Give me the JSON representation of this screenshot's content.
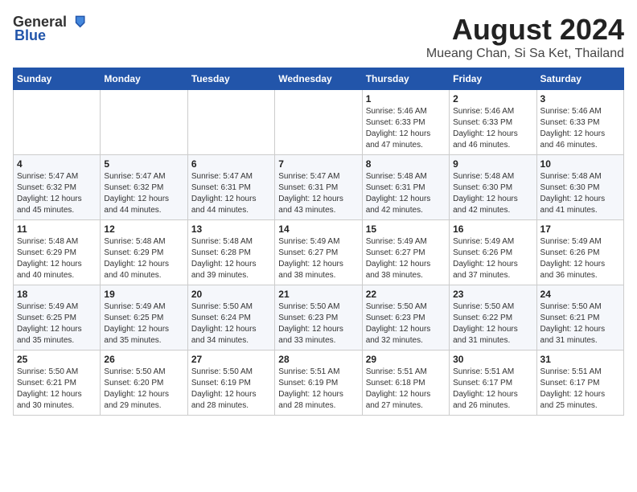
{
  "header": {
    "logo_general": "General",
    "logo_blue": "Blue",
    "month_year": "August 2024",
    "location": "Mueang Chan, Si Sa Ket, Thailand"
  },
  "days_of_week": [
    "Sunday",
    "Monday",
    "Tuesday",
    "Wednesday",
    "Thursday",
    "Friday",
    "Saturday"
  ],
  "weeks": [
    {
      "days": [
        {
          "number": "",
          "info": ""
        },
        {
          "number": "",
          "info": ""
        },
        {
          "number": "",
          "info": ""
        },
        {
          "number": "",
          "info": ""
        },
        {
          "number": "1",
          "sunrise": "5:46 AM",
          "sunset": "6:33 PM",
          "daylight": "12 hours and 47 minutes."
        },
        {
          "number": "2",
          "sunrise": "5:46 AM",
          "sunset": "6:33 PM",
          "daylight": "12 hours and 46 minutes."
        },
        {
          "number": "3",
          "sunrise": "5:46 AM",
          "sunset": "6:33 PM",
          "daylight": "12 hours and 46 minutes."
        }
      ]
    },
    {
      "days": [
        {
          "number": "4",
          "sunrise": "5:47 AM",
          "sunset": "6:32 PM",
          "daylight": "12 hours and 45 minutes."
        },
        {
          "number": "5",
          "sunrise": "5:47 AM",
          "sunset": "6:32 PM",
          "daylight": "12 hours and 44 minutes."
        },
        {
          "number": "6",
          "sunrise": "5:47 AM",
          "sunset": "6:31 PM",
          "daylight": "12 hours and 44 minutes."
        },
        {
          "number": "7",
          "sunrise": "5:47 AM",
          "sunset": "6:31 PM",
          "daylight": "12 hours and 43 minutes."
        },
        {
          "number": "8",
          "sunrise": "5:48 AM",
          "sunset": "6:31 PM",
          "daylight": "12 hours and 42 minutes."
        },
        {
          "number": "9",
          "sunrise": "5:48 AM",
          "sunset": "6:30 PM",
          "daylight": "12 hours and 42 minutes."
        },
        {
          "number": "10",
          "sunrise": "5:48 AM",
          "sunset": "6:30 PM",
          "daylight": "12 hours and 41 minutes."
        }
      ]
    },
    {
      "days": [
        {
          "number": "11",
          "sunrise": "5:48 AM",
          "sunset": "6:29 PM",
          "daylight": "12 hours and 40 minutes."
        },
        {
          "number": "12",
          "sunrise": "5:48 AM",
          "sunset": "6:29 PM",
          "daylight": "12 hours and 40 minutes."
        },
        {
          "number": "13",
          "sunrise": "5:48 AM",
          "sunset": "6:28 PM",
          "daylight": "12 hours and 39 minutes."
        },
        {
          "number": "14",
          "sunrise": "5:49 AM",
          "sunset": "6:27 PM",
          "daylight": "12 hours and 38 minutes."
        },
        {
          "number": "15",
          "sunrise": "5:49 AM",
          "sunset": "6:27 PM",
          "daylight": "12 hours and 38 minutes."
        },
        {
          "number": "16",
          "sunrise": "5:49 AM",
          "sunset": "6:26 PM",
          "daylight": "12 hours and 37 minutes."
        },
        {
          "number": "17",
          "sunrise": "5:49 AM",
          "sunset": "6:26 PM",
          "daylight": "12 hours and 36 minutes."
        }
      ]
    },
    {
      "days": [
        {
          "number": "18",
          "sunrise": "5:49 AM",
          "sunset": "6:25 PM",
          "daylight": "12 hours and 35 minutes."
        },
        {
          "number": "19",
          "sunrise": "5:49 AM",
          "sunset": "6:25 PM",
          "daylight": "12 hours and 35 minutes."
        },
        {
          "number": "20",
          "sunrise": "5:50 AM",
          "sunset": "6:24 PM",
          "daylight": "12 hours and 34 minutes."
        },
        {
          "number": "21",
          "sunrise": "5:50 AM",
          "sunset": "6:23 PM",
          "daylight": "12 hours and 33 minutes."
        },
        {
          "number": "22",
          "sunrise": "5:50 AM",
          "sunset": "6:23 PM",
          "daylight": "12 hours and 32 minutes."
        },
        {
          "number": "23",
          "sunrise": "5:50 AM",
          "sunset": "6:22 PM",
          "daylight": "12 hours and 31 minutes."
        },
        {
          "number": "24",
          "sunrise": "5:50 AM",
          "sunset": "6:21 PM",
          "daylight": "12 hours and 31 minutes."
        }
      ]
    },
    {
      "days": [
        {
          "number": "25",
          "sunrise": "5:50 AM",
          "sunset": "6:21 PM",
          "daylight": "12 hours and 30 minutes."
        },
        {
          "number": "26",
          "sunrise": "5:50 AM",
          "sunset": "6:20 PM",
          "daylight": "12 hours and 29 minutes."
        },
        {
          "number": "27",
          "sunrise": "5:50 AM",
          "sunset": "6:19 PM",
          "daylight": "12 hours and 28 minutes."
        },
        {
          "number": "28",
          "sunrise": "5:51 AM",
          "sunset": "6:19 PM",
          "daylight": "12 hours and 28 minutes."
        },
        {
          "number": "29",
          "sunrise": "5:51 AM",
          "sunset": "6:18 PM",
          "daylight": "12 hours and 27 minutes."
        },
        {
          "number": "30",
          "sunrise": "5:51 AM",
          "sunset": "6:17 PM",
          "daylight": "12 hours and 26 minutes."
        },
        {
          "number": "31",
          "sunrise": "5:51 AM",
          "sunset": "6:17 PM",
          "daylight": "12 hours and 25 minutes."
        }
      ]
    }
  ]
}
